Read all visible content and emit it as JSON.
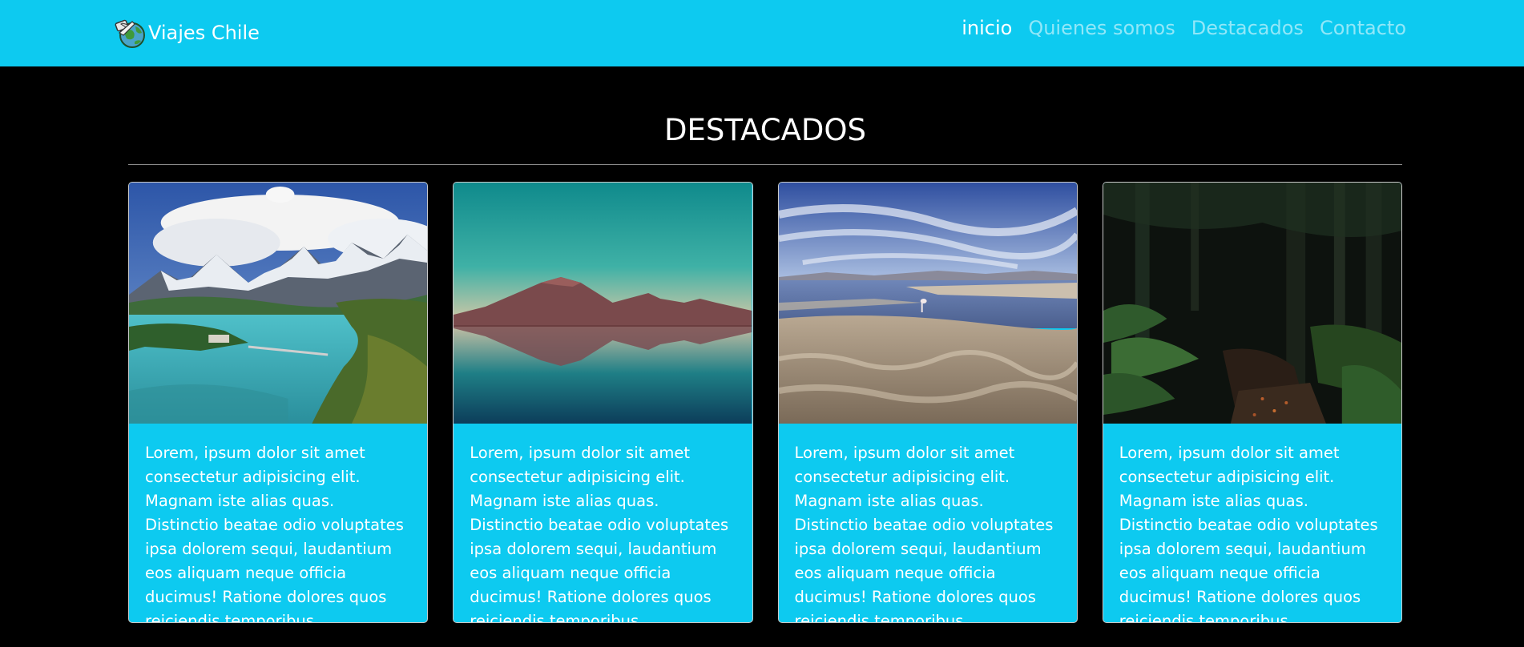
{
  "navbar": {
    "brand": "Viajes Chile",
    "brand_icon": "travel-globe-logo",
    "links": [
      {
        "label": "inicio",
        "active": true
      },
      {
        "label": "Quienes somos",
        "active": false
      },
      {
        "label": "Destacados",
        "active": false
      },
      {
        "label": "Contacto",
        "active": false
      }
    ]
  },
  "section": {
    "title": "DESTACADOS"
  },
  "cards": [
    {
      "image": "torres-del-paine-lake-photo",
      "text": "Lorem, ipsum dolor sit amet consectetur adipisicing elit. Magnam iste alias quas. Distinctio beatae odio voluptates ipsa dolorem sequi, laudantium eos aliquam neque officia ducimus! Ratione dolores quos reiciendis temporibus."
    },
    {
      "image": "volcano-reflection-lake-photo",
      "text": "Lorem, ipsum dolor sit amet consectetur adipisicing elit. Magnam iste alias quas. Distinctio beatae odio voluptates ipsa dolorem sequi, laudantium eos aliquam neque officia ducimus! Ratione dolores quos reiciendis temporibus."
    },
    {
      "image": "salt-flat-lagoon-photo",
      "text": "Lorem, ipsum dolor sit amet consectetur adipisicing elit. Magnam iste alias quas. Distinctio beatae odio voluptates ipsa dolorem sequi, laudantium eos aliquam neque officia ducimus! Ratione dolores quos reiciendis temporibus."
    },
    {
      "image": "forest-trail-photo",
      "text": "Lorem, ipsum dolor sit amet consectetur adipisicing elit. Magnam iste alias quas. Distinctio beatae odio voluptates ipsa dolorem sequi, laudantium eos aliquam neque officia ducimus! Ratione dolores quos reiciendis temporibus."
    }
  ],
  "colors": {
    "accent": "#0dcaf0",
    "background": "#000000",
    "text": "#ffffff"
  }
}
